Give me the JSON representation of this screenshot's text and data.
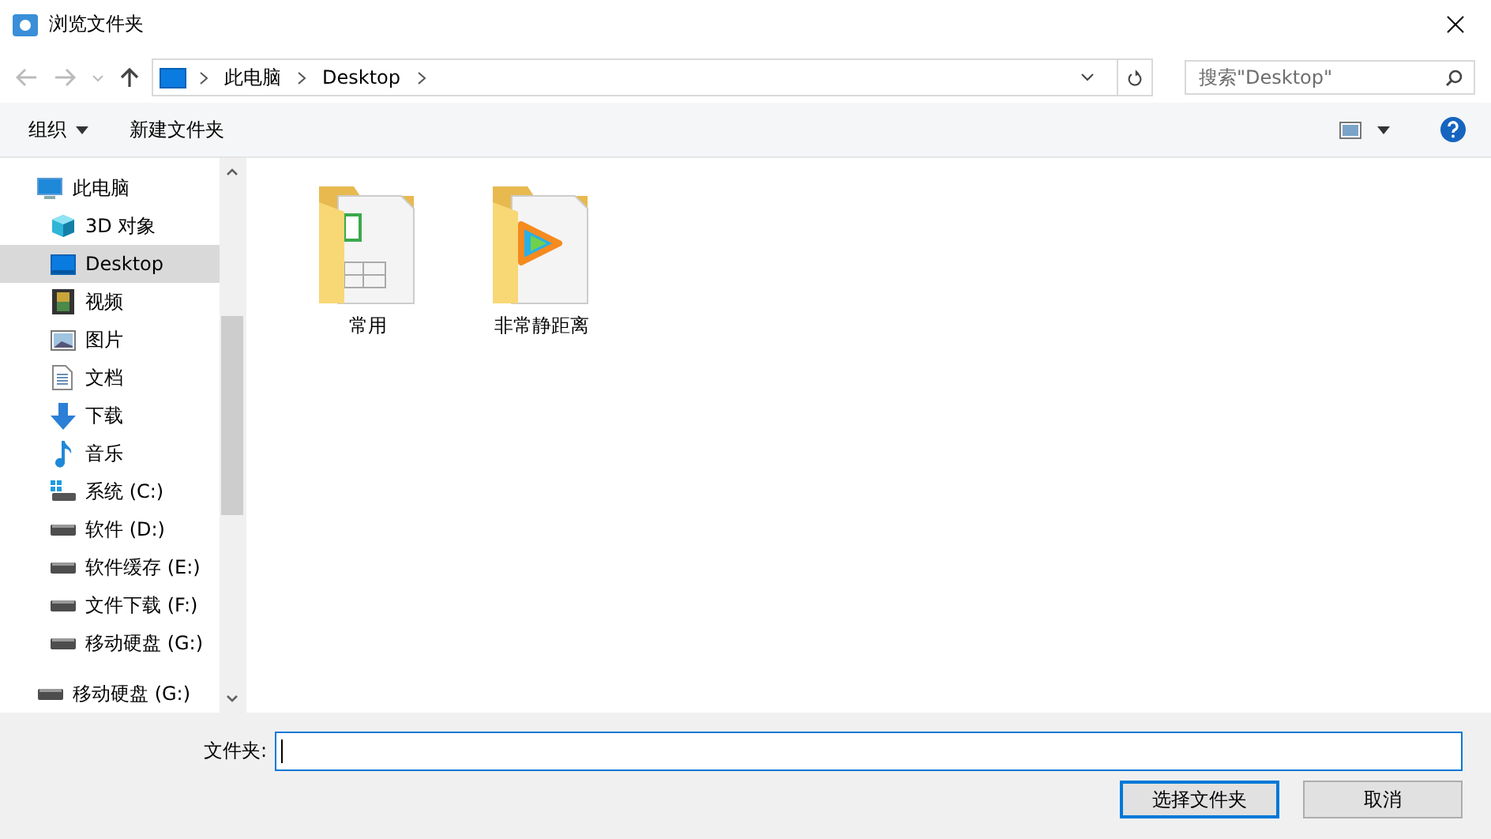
{
  "window": {
    "title": "浏览文件夹"
  },
  "address": {
    "path": [
      "此电脑",
      "Desktop"
    ]
  },
  "search": {
    "placeholder": "搜索\"Desktop\""
  },
  "toolbar": {
    "buttons": [
      {
        "label": "组织",
        "dropdown": true
      },
      {
        "label": "新建文件夹",
        "dropdown": false
      }
    ]
  },
  "sidebar": {
    "items": [
      {
        "label": "此电脑",
        "kind": "pc",
        "selected": false,
        "children": [
          {
            "label": "3D 对象",
            "kind": "cube",
            "selected": false
          },
          {
            "label": "Desktop",
            "kind": "desktop",
            "selected": true
          },
          {
            "label": "视频",
            "kind": "video",
            "selected": false
          },
          {
            "label": "图片",
            "kind": "picture",
            "selected": false
          },
          {
            "label": "文档",
            "kind": "doc",
            "selected": false
          },
          {
            "label": "下载",
            "kind": "download",
            "selected": false
          },
          {
            "label": "音乐",
            "kind": "music",
            "selected": false
          },
          {
            "label": "系统 (C:)",
            "kind": "system",
            "selected": false
          },
          {
            "label": "软件 (D:)",
            "kind": "drive",
            "selected": false
          },
          {
            "label": "软件缓存 (E:)",
            "kind": "drive",
            "selected": false
          },
          {
            "label": "文件下载 (F:)",
            "kind": "drive",
            "selected": false
          },
          {
            "label": "移动硬盘 (G:)",
            "kind": "drive",
            "selected": false
          }
        ]
      },
      {
        "label": "移动硬盘 (G:)",
        "kind": "drive",
        "selected": false
      }
    ]
  },
  "folders": [
    {
      "name": "常用",
      "kind": "sheet"
    },
    {
      "name": "非常静距离",
      "kind": "player"
    }
  ],
  "footer": {
    "label": "文件夹:",
    "buttons": [
      {
        "label": "选择文件夹",
        "default": true
      },
      {
        "label": "取消",
        "default": false
      }
    ]
  }
}
